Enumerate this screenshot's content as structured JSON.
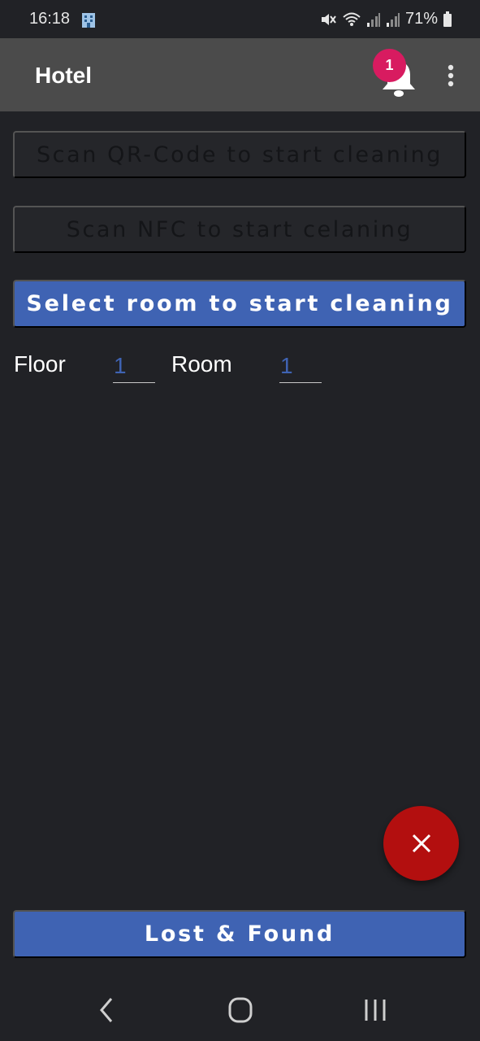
{
  "status_bar": {
    "time": "16:18",
    "battery_percent": "71%",
    "icons": [
      "hotel-app-notification-icon",
      "mute-icon",
      "wifi-icon",
      "signal-icon",
      "signal-icon",
      "battery-icon"
    ]
  },
  "appbar": {
    "title": "Hotel",
    "notification_count": "1",
    "icons": [
      "bell-icon",
      "more-vert-icon"
    ]
  },
  "actions": {
    "scan_qr_label": "Scan QR-Code to start cleaning",
    "scan_nfc_label": "Scan NFC to start celaning",
    "select_room_label": "Select room to start cleaning"
  },
  "room_selector": {
    "floor_label": "Floor",
    "floor_value": "1",
    "room_label": "Room",
    "room_value": "1"
  },
  "fab": {
    "icon": "close-icon"
  },
  "lost_found_label": "Lost & Found",
  "nav_bar": {
    "icons": [
      "back-icon",
      "home-icon",
      "recents-icon"
    ]
  },
  "colors": {
    "background": "#212226",
    "appbar": "#4b4b4b",
    "primary": "#3f63b3",
    "badge": "#d81b60",
    "fab": "#b30f0f"
  }
}
